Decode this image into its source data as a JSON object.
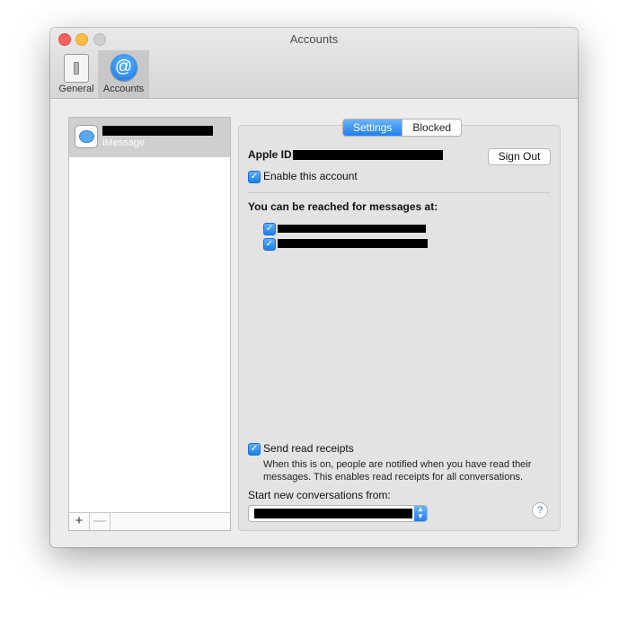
{
  "window": {
    "title": "Accounts"
  },
  "toolbar": {
    "general_label": "General",
    "accounts_label": "Accounts",
    "accounts_icon_glyph": "@"
  },
  "accounts_list": {
    "items": [
      {
        "service": "iMessage"
      }
    ],
    "add_glyph": "+",
    "remove_glyph": "—"
  },
  "tabs": {
    "settings": "Settings",
    "blocked": "Blocked"
  },
  "settings": {
    "apple_id_label": "Apple ID:",
    "sign_out": "Sign Out",
    "enable_account": "Enable this account",
    "enable_account_checked": true,
    "reached_at_label": "You can be reached for messages at:",
    "reach_addresses_checked": [
      true,
      true
    ],
    "send_read_receipts": "Send read receipts",
    "send_read_receipts_checked": true,
    "read_receipts_note": "When this is on, people are notified when you have read their messages. This enables read receipts for all conversations.",
    "start_from_label": "Start new conversations from:",
    "help_glyph": "?"
  },
  "colors": {
    "accent": "#1f7fef",
    "traffic_close": "#fc605c",
    "traffic_min": "#fdbc40"
  }
}
